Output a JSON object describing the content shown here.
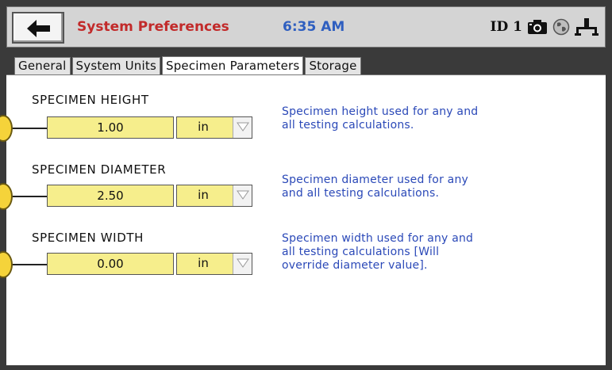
{
  "header": {
    "title": "System Preferences",
    "time": "6:35 AM",
    "device_id": "ID 1"
  },
  "icons": {
    "back": "back-arrow-icon",
    "camera": "camera-icon",
    "globe": "globe-icon",
    "network": "network-icon"
  },
  "tabs": [
    {
      "label": "General"
    },
    {
      "label": "System Units"
    },
    {
      "label": "Specimen Parameters"
    },
    {
      "label": "Storage"
    }
  ],
  "active_tab": "Specimen Parameters",
  "fields": [
    {
      "label": "SPECIMEN HEIGHT",
      "value": "1.00",
      "unit": "in",
      "description": [
        "Specimen height used for any and",
        "all testing calculations."
      ]
    },
    {
      "label": "SPECIMEN DIAMETER",
      "value": "2.50",
      "unit": "in",
      "description": [
        "Specimen diameter used for any",
        "and all testing calculations."
      ]
    },
    {
      "label": "SPECIMEN WIDTH",
      "value": "0.00",
      "unit": "in",
      "description": [
        "Specimen width used for any and",
        "all testing calculations [Will",
        "override diameter value]."
      ]
    }
  ],
  "colors": {
    "title": "#c22a2a",
    "clock": "#2f5fc0",
    "description": "#2b49b8",
    "field_fill": "#f6ee8c",
    "marker": "#f5d33a"
  }
}
